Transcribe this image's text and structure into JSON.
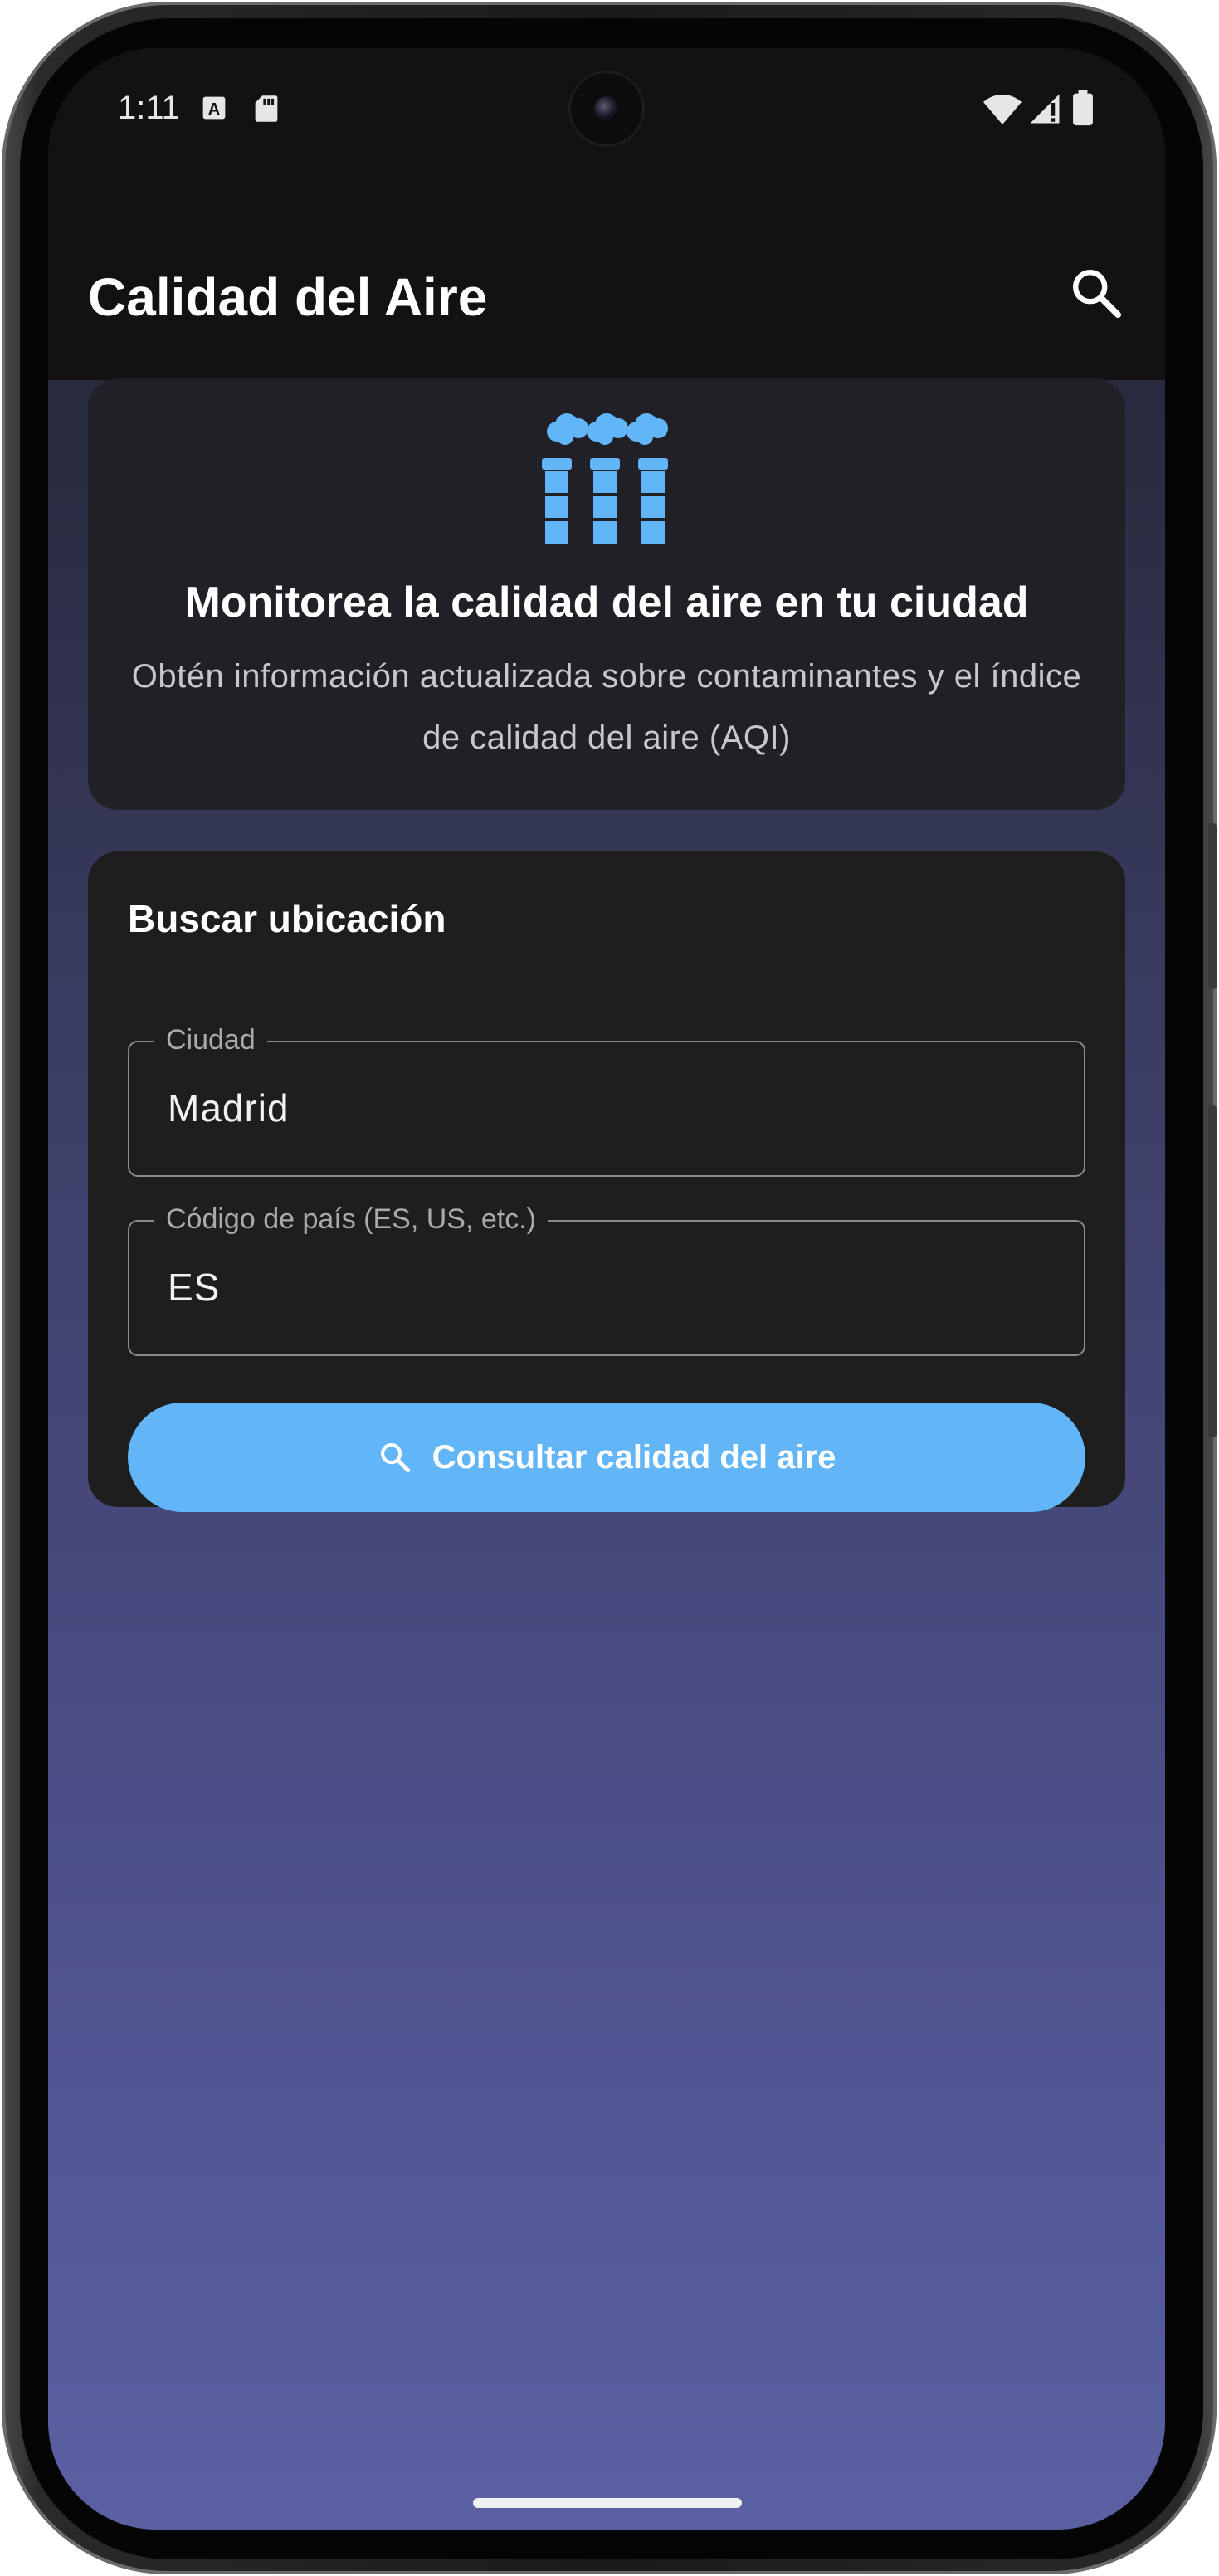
{
  "status_bar": {
    "time": "1:11",
    "left_icons": [
      "font-download-icon",
      "sd-card-icon"
    ],
    "right_icons": [
      "wifi-icon",
      "signal-alert-icon",
      "battery-icon"
    ]
  },
  "app_bar": {
    "title": "Calidad del Aire",
    "action_icon": "search-icon"
  },
  "hero": {
    "icon": "factory-icon",
    "title": "Monitorea la calidad del aire en tu ciudad",
    "subtitle": "Obtén información actualizada sobre contaminantes y el índice de calidad del aire (AQI)"
  },
  "search_card": {
    "title": "Buscar ubicación",
    "city_field": {
      "label": "Ciudad",
      "value": "Madrid"
    },
    "country_field": {
      "label": "Código de país (ES, US, etc.)",
      "value": "ES"
    },
    "submit_button": {
      "label": "Consultar calidad del aire",
      "icon": "search-icon"
    }
  },
  "colors": {
    "accent": "#62b5f6",
    "card_bg": "#1e1e1e",
    "appbar_bg": "#121212",
    "gradient_top": "#1f2131",
    "gradient_bottom": "#5b60a3"
  }
}
